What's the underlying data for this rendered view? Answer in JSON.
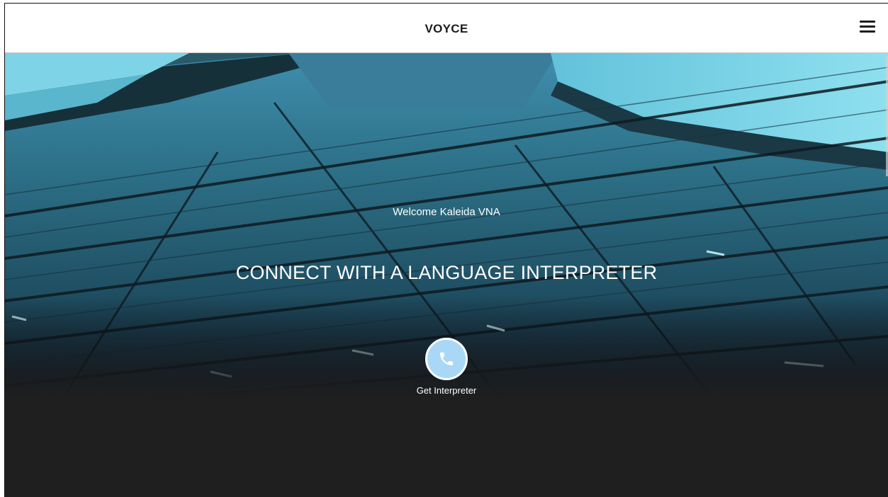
{
  "header": {
    "brand": "VOYCE",
    "menu_icon": "hamburger-menu-icon"
  },
  "hero": {
    "welcome_text": "Welcome Kaleida VNA",
    "headline": "CONNECT WITH A LANGUAGE INTERPRETER",
    "call_button": {
      "icon": "phone-icon",
      "label": "Get Interpreter"
    }
  },
  "colors": {
    "call_button_fill": "#a9d8f6",
    "header_bg": "#ffffff",
    "page_bottom_bg": "#1f1f1f"
  }
}
